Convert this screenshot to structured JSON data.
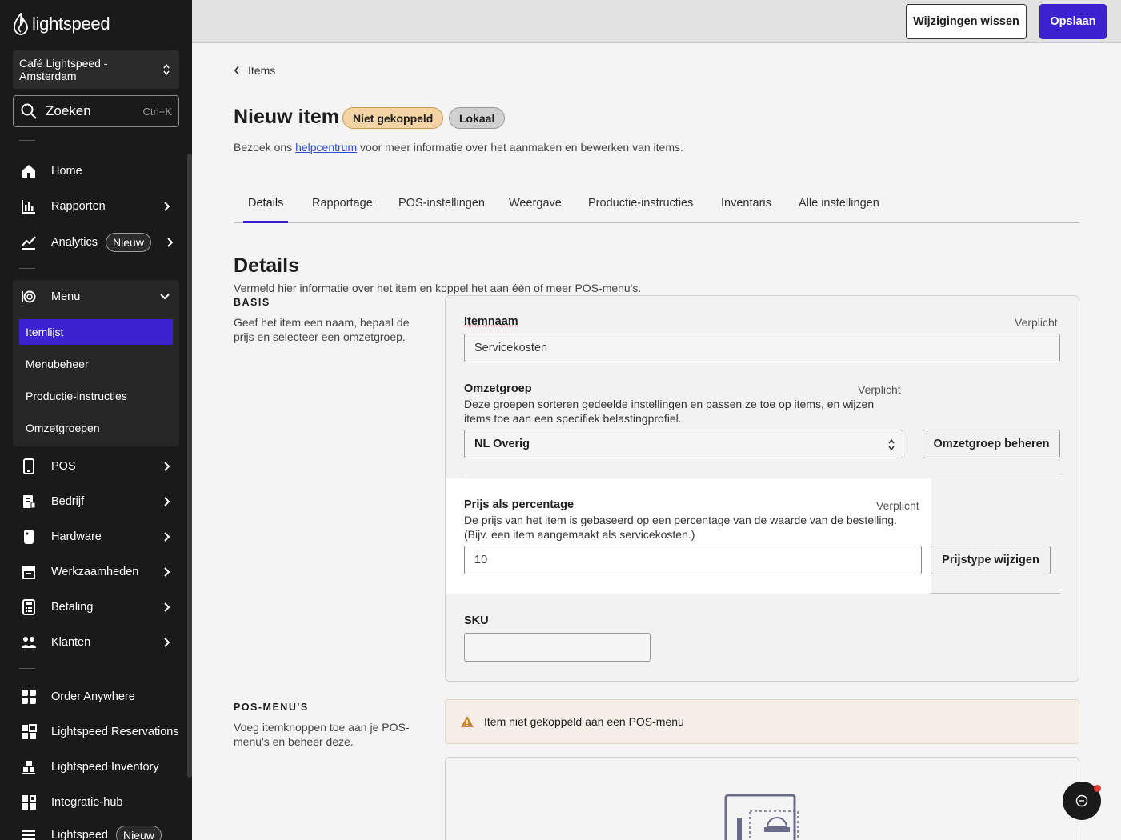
{
  "sidebar": {
    "brand": "lightspeed",
    "location": "Café Lightspeed - Amsterdam",
    "search": {
      "placeholder": "Zoeken",
      "shortcut": "Ctrl+K"
    },
    "nav": {
      "home": "Home",
      "rapporten": "Rapporten",
      "analytics": "Analytics",
      "analytics_badge": "Nieuw",
      "menu": "Menu",
      "pos": "POS",
      "bedrijf": "Bedrijf",
      "hardware": "Hardware",
      "werkzaamheden": "Werkzaamheden",
      "betaling": "Betaling",
      "klanten": "Klanten",
      "order_anywhere": "Order Anywhere",
      "reservations": "Lightspeed Reservations",
      "inventory": "Lightspeed Inventory",
      "integratie": "Integratie-hub",
      "lightspeed_more": "Lightspeed",
      "lightspeed_more_badge": "Nieuw"
    },
    "menu_sub": [
      "Itemlijst",
      "Menubeheer",
      "Productie-instructies",
      "Omzetgroepen"
    ]
  },
  "topbar": {
    "discard_label": "Wijzigingen wissen",
    "save_label": "Opslaan"
  },
  "breadcrumb": "Items",
  "page": {
    "title": "Nieuw item",
    "status_badge": "Niet gekoppeld",
    "scope_badge": "Lokaal",
    "help_prefix": "Bezoek ons ",
    "help_link": "helpcentrum",
    "help_suffix": " voor meer informatie over het aanmaken en bewerken van items."
  },
  "tabs": [
    "Details",
    "Rapportage",
    "POS-instellingen",
    "Weergave",
    "Productie-instructies",
    "Inventaris",
    "Alle instellingen"
  ],
  "details": {
    "heading": "Details",
    "description": "Vermeld hier informatie over het item en koppel het aan één of meer POS-menu's.",
    "basis": {
      "label": "BASIS",
      "description": "Geef het item een naam, bepaal de prijs en selecteer een omzetgroep."
    },
    "item_name": {
      "label": "Itemnaam",
      "required": "Verplicht",
      "value": "Servicekosten"
    },
    "revenue_group": {
      "label": "Omzetgroep",
      "required": "Verplicht",
      "description": "Deze groepen sorteren gedeelde instellingen en passen ze toe op items, en wijzen items toe aan een specifiek belastingprofiel.",
      "value": "NL Overig",
      "manage_label": "Omzetgroep beheren"
    },
    "price_pct": {
      "label": "Prijs als percentage",
      "required": "Verplicht",
      "description": "De prijs van het item is gebaseerd op een percentage van de waarde van de bestelling. (Bijv. een item aangemaakt als servicekosten.)",
      "value": "10",
      "change_label": "Prijstype wijzigen"
    },
    "sku": {
      "label": "SKU",
      "value": ""
    }
  },
  "pos_menus": {
    "label": "POS-MENU'S",
    "description": "Voeg itemknoppen toe aan je POS-menu's en beheer deze.",
    "alert": "Item niet gekoppeld aan een POS-menu"
  },
  "colors": {
    "accent": "#3b21d0",
    "sidebar_bg": "#1a1a1a",
    "warning": "#c9852a"
  }
}
